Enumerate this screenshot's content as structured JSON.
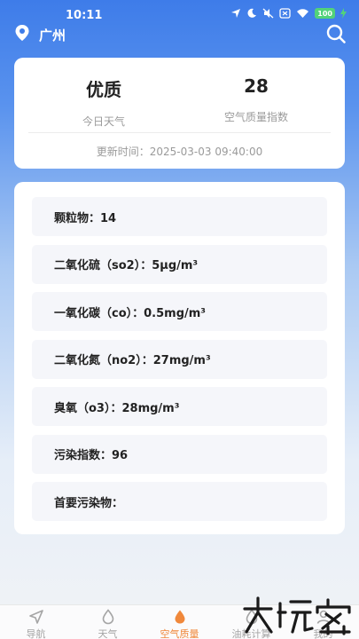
{
  "status_bar": {
    "time": "10:11",
    "battery": "100"
  },
  "header": {
    "city": "广州"
  },
  "summary": {
    "weather_value": "优质",
    "weather_label": "今日天气",
    "aqi_value": "28",
    "aqi_label": "空气质量指数",
    "update_time": "更新时间：2025-03-03 09:40:00"
  },
  "pollutants": [
    "颗粒物：14",
    "二氧化硫（so2）：5μg/m³",
    "一氧化碳（co）：0.5mg/m³",
    "二氧化氮（no2）：27mg/m³",
    "臭氧（o3）：28mg/m³",
    "污染指数：96",
    "首要污染物："
  ],
  "nav": {
    "items": [
      "导航",
      "天气",
      "空气质量",
      "油耗计算",
      "我的"
    ],
    "active_index": 2
  },
  "colors": {
    "accent": "#f0883b",
    "header_blue": "#3e7ce9"
  }
}
